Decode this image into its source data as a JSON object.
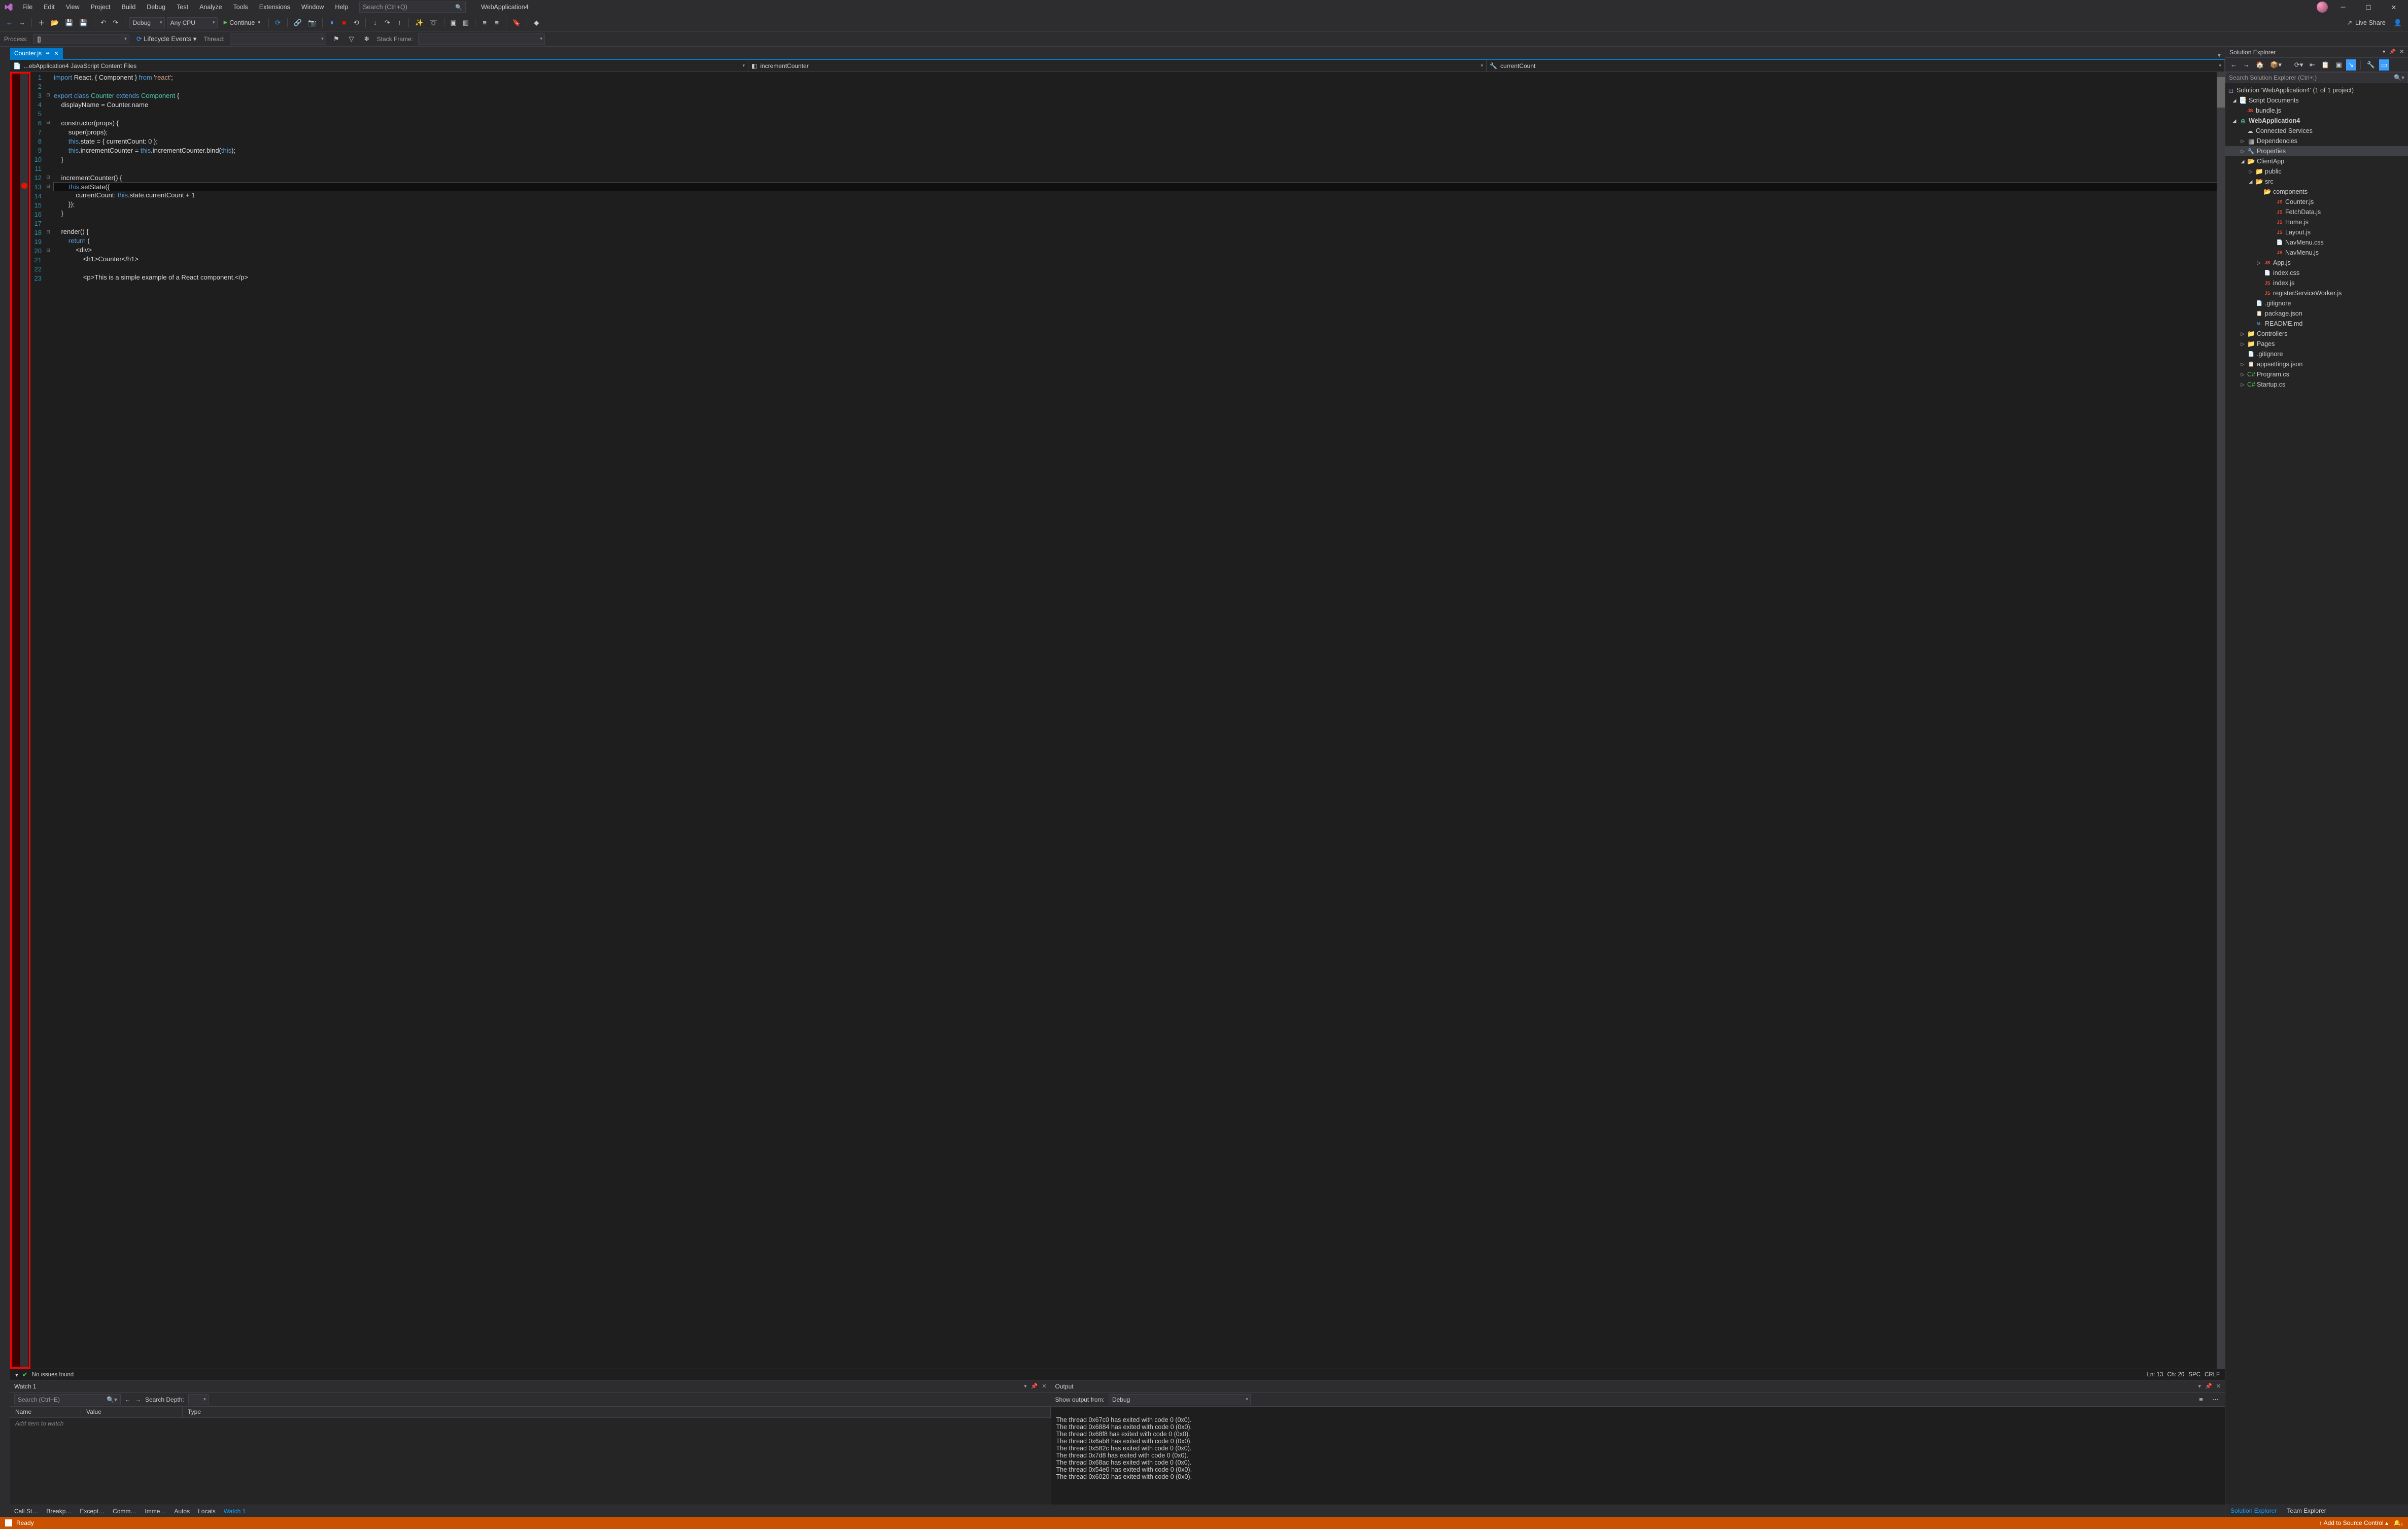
{
  "title": {
    "app": "WebApplication4"
  },
  "menu": [
    "File",
    "Edit",
    "View",
    "Project",
    "Build",
    "Debug",
    "Test",
    "Analyze",
    "Tools",
    "Extensions",
    "Window",
    "Help"
  ],
  "search": {
    "placeholder": "Search (Ctrl+Q)"
  },
  "toolbar": {
    "config": "Debug",
    "platform": "Any CPU",
    "continue": "Continue",
    "liveshare": "Live Share"
  },
  "toolbar2": {
    "process": "Process:",
    "lifecycle": "Lifecycle Events",
    "thread": "Thread:",
    "stack": "Stack Frame:"
  },
  "tab": {
    "name": "Counter.js"
  },
  "nav": {
    "scope": "...ebApplication4 JavaScript Content Files",
    "member": "incrementCounter",
    "detail": "currentCount"
  },
  "code": {
    "lines": [
      "1",
      "2",
      "3",
      "4",
      "5",
      "6",
      "7",
      "8",
      "9",
      "10",
      "11",
      "12",
      "13",
      "14",
      "15",
      "16",
      "17",
      "18",
      "19",
      "20",
      "21",
      "22",
      "23"
    ],
    "bp_line": "13",
    "l1a": "import",
    "l1b": " React, { Component } ",
    "l1c": "from",
    "l1d": " 'react'",
    "l1e": ";",
    "l3a": "export",
    "l3b": " class",
    "l3c": " Counter",
    "l3d": " extends",
    "l3e": " Component",
    "l3f": " {",
    "l4": "    displayName = Counter.name",
    "l6": "    constructor(props) {",
    "l7": "        super(props);",
    "l8a": "        ",
    "l8b": "this",
    "l8c": ".state = { currentCount: ",
    "l8d": "0",
    "l8e": " };",
    "l9a": "        ",
    "l9b": "this",
    "l9c": ".incrementCounter = ",
    "l9d": "this",
    "l9e": ".incrementCounter.bind(",
    "l9f": "this",
    "l9g": ");",
    "l10": "    }",
    "l12": "    incrementCounter() {",
    "l13a": "        ",
    "l13b": "this",
    "l13c": ".setState({",
    "l14a": "            currentCount: ",
    "l14b": "this",
    "l14c": ".state.currentCount + ",
    "l14d": "1",
    "l15": "        });",
    "l16": "    }",
    "l18": "    render() {",
    "l19a": "        ",
    "l19b": "return",
    "l19c": " (",
    "l20": "            <div>",
    "l21": "                <h1>Counter</h1>",
    "l23": "                <p>This is a simple example of a React component.</p>"
  },
  "editor_status": {
    "issues": "No issues found",
    "ln": "Ln: 13",
    "ch": "Ch: 20",
    "ws": "SPC",
    "eol": "CRLF"
  },
  "watch": {
    "title": "Watch 1",
    "search": "Search (Ctrl+E)",
    "depth": "Search Depth:",
    "cols": [
      "Name",
      "Value",
      "Type"
    ],
    "add": "Add item to watch"
  },
  "output": {
    "title": "Output",
    "from_label": "Show output from:",
    "from": "Debug",
    "lines": [
      "The thread 0x67c0 has exited with code 0 (0x0).",
      "The thread 0x6884 has exited with code 0 (0x0).",
      "The thread 0x68f8 has exited with code 0 (0x0).",
      "The thread 0x6ab8 has exited with code 0 (0x0).",
      "The thread 0x582c has exited with code 0 (0x0).",
      "The thread 0x7d8 has exited with code 0 (0x0).",
      "The thread 0x68ac has exited with code 0 (0x0).",
      "The thread 0x54e0 has exited with code 0 (0x0).",
      "The thread 0x6020 has exited with code 0 (0x0)."
    ]
  },
  "bottom_tabs": [
    "Call St…",
    "Breakp…",
    "Except…",
    "Comm…",
    "Imme…",
    "Autos",
    "Locals",
    "Watch 1"
  ],
  "solution": {
    "title": "Solution Explorer",
    "search": "Search Solution Explorer (Ctrl+;)",
    "root": "Solution 'WebApplication4' (1 of 1 project)",
    "script_docs": "Script Documents",
    "bundle": "bundle.js",
    "project": "WebApplication4",
    "connected": "Connected Services",
    "deps": "Dependencies",
    "props": "Properties",
    "clientapp": "ClientApp",
    "public": "public",
    "src": "src",
    "components": "components",
    "files_components": [
      "Counter.js",
      "FetchData.js",
      "Home.js",
      "Layout.js",
      "NavMenu.css",
      "NavMenu.js"
    ],
    "appjs": "App.js",
    "indexcss": "index.css",
    "indexjs": "index.js",
    "regsw": "registerServiceWorker.js",
    "gitignore": ".gitignore",
    "pkg": "package.json",
    "readme": "README.md",
    "controllers": "Controllers",
    "pages": "Pages",
    "gitignore2": ".gitignore",
    "appsettings": "appsettings.json",
    "program": "Program.cs",
    "startup": "Startup.cs",
    "tabs": [
      "Solution Explorer",
      "Team Explorer"
    ]
  },
  "status": {
    "ready": "Ready",
    "src": "Add to Source Control"
  }
}
